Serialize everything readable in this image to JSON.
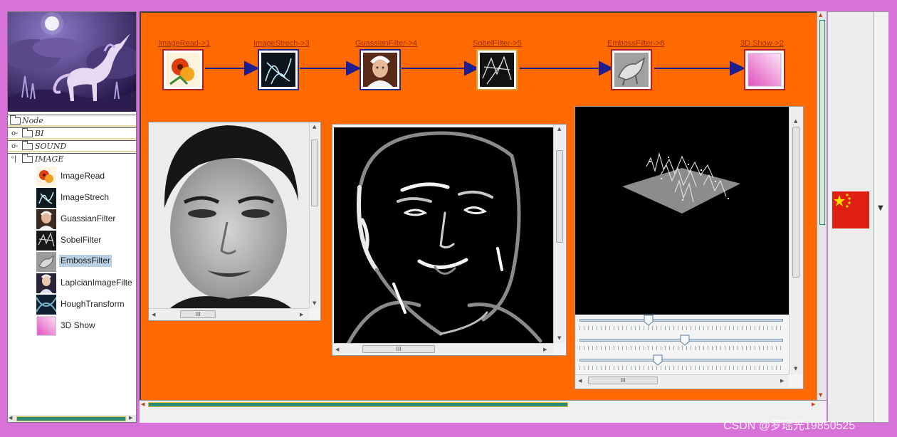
{
  "tree": {
    "root_label": "Node",
    "groups": [
      {
        "label": "BI",
        "expanded": false
      },
      {
        "label": "SOUND",
        "expanded": false
      },
      {
        "label": "IMAGE",
        "expanded": true
      }
    ],
    "image_items": [
      {
        "label": "ImageRead",
        "icon": "flower-photo-icon"
      },
      {
        "label": "ImageStrech",
        "icon": "stretch-sketch-icon"
      },
      {
        "label": "GuassianFilter",
        "icon": "portrait-icon"
      },
      {
        "label": "SobelFilter",
        "icon": "edge-sketch-icon"
      },
      {
        "label": "EmbossFilter",
        "icon": "emboss-horse-icon",
        "selected": true
      },
      {
        "label": "LaplcianImageFilte",
        "icon": "portrait-icon"
      },
      {
        "label": "HoughTransform",
        "icon": "hough-icon"
      },
      {
        "label": "3D Show",
        "icon": "gradient-square-icon"
      }
    ]
  },
  "pipeline": {
    "nodes": [
      {
        "label": "ImageRead->1",
        "icon": "flower-photo-icon"
      },
      {
        "label": "ImageStrech->3",
        "icon": "stretch-sketch-icon"
      },
      {
        "label": "GuassianFilter->4",
        "icon": "portrait-icon"
      },
      {
        "label": "SobelFilter->5",
        "icon": "edge-sketch-icon"
      },
      {
        "label": "EmbossFilter->6",
        "icon": "emboss-horse-icon"
      },
      {
        "label": "3D Show->2",
        "icon": "gradient-square-icon"
      }
    ]
  },
  "scroll_thumb_grip": "III",
  "sliders": [
    {
      "value": 0.33
    },
    {
      "value": 0.52
    },
    {
      "value": 0.38
    }
  ],
  "flag_icon": "china-flag-icon",
  "watermark": "CSDN @罗瑶光19850525",
  "colors": {
    "canvas": "#ff6a00",
    "window_border": "#d872d8",
    "selection": "#b8cfe4",
    "arrow": "#1e1e8c"
  }
}
